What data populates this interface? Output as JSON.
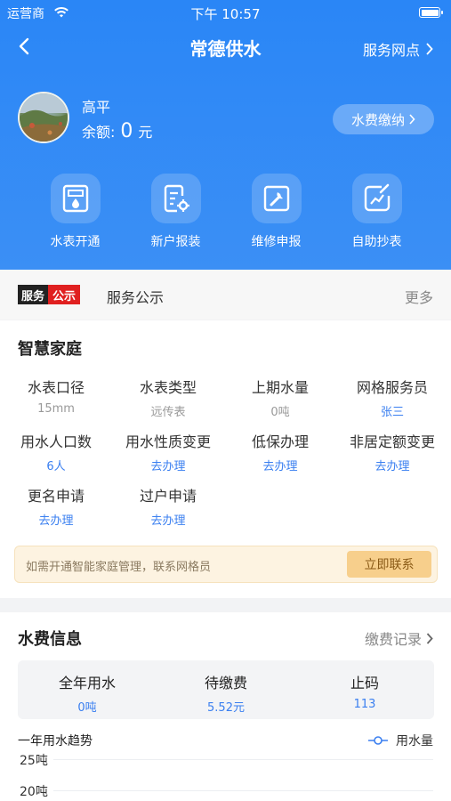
{
  "status_bar": {
    "carrier": "运营商",
    "time": "下午 10:57"
  },
  "nav": {
    "title": "常德供水",
    "right_label": "服务网点"
  },
  "user": {
    "name": "高平",
    "balance_label": "余额:",
    "balance_value": "0",
    "balance_unit": "元",
    "pay_button": "水费缴纳"
  },
  "quick_actions": [
    {
      "label": "水表开通",
      "icon": "water-meter-icon"
    },
    {
      "label": "新户报装",
      "icon": "form-settings-icon"
    },
    {
      "label": "维修申报",
      "icon": "wrench-icon"
    },
    {
      "label": "自助抄表",
      "icon": "edit-chart-icon"
    }
  ],
  "notice": {
    "tag_left": "服务",
    "tag_right": "公示",
    "text": "服务公示",
    "more": "更多"
  },
  "smart_family": {
    "title": "智慧家庭",
    "items": [
      {
        "label": "水表口径",
        "value": "15mm"
      },
      {
        "label": "水表类型",
        "value": "远传表"
      },
      {
        "label": "上期水量",
        "value": "0吨"
      },
      {
        "label": "网格服务员",
        "value": "张三"
      },
      {
        "label": "用水人口数",
        "value": "6人"
      },
      {
        "label": "用水性质变更",
        "value": "去办理"
      },
      {
        "label": "低保办理",
        "value": "去办理"
      },
      {
        "label": "非居定额变更",
        "value": "去办理"
      },
      {
        "label": "更名申请",
        "value": "去办理"
      },
      {
        "label": "过户申请",
        "value": "去办理"
      }
    ],
    "tip_text": "如需开通智能家庭管理，联系网格员",
    "tip_button": "立即联系"
  },
  "water_fee": {
    "title": "水费信息",
    "records_link": "缴费记录",
    "stats": [
      {
        "label": "全年用水",
        "value": "0吨"
      },
      {
        "label": "待缴费",
        "value": "5.52元"
      },
      {
        "label": "止码",
        "value": "113"
      }
    ],
    "trend_title": "一年用水趋势",
    "legend": "用水量",
    "y_ticks": [
      "25吨",
      "20吨"
    ]
  },
  "colors": {
    "primary": "#2a86f6",
    "link": "#3a7ff0",
    "tag_red": "#e02020"
  }
}
